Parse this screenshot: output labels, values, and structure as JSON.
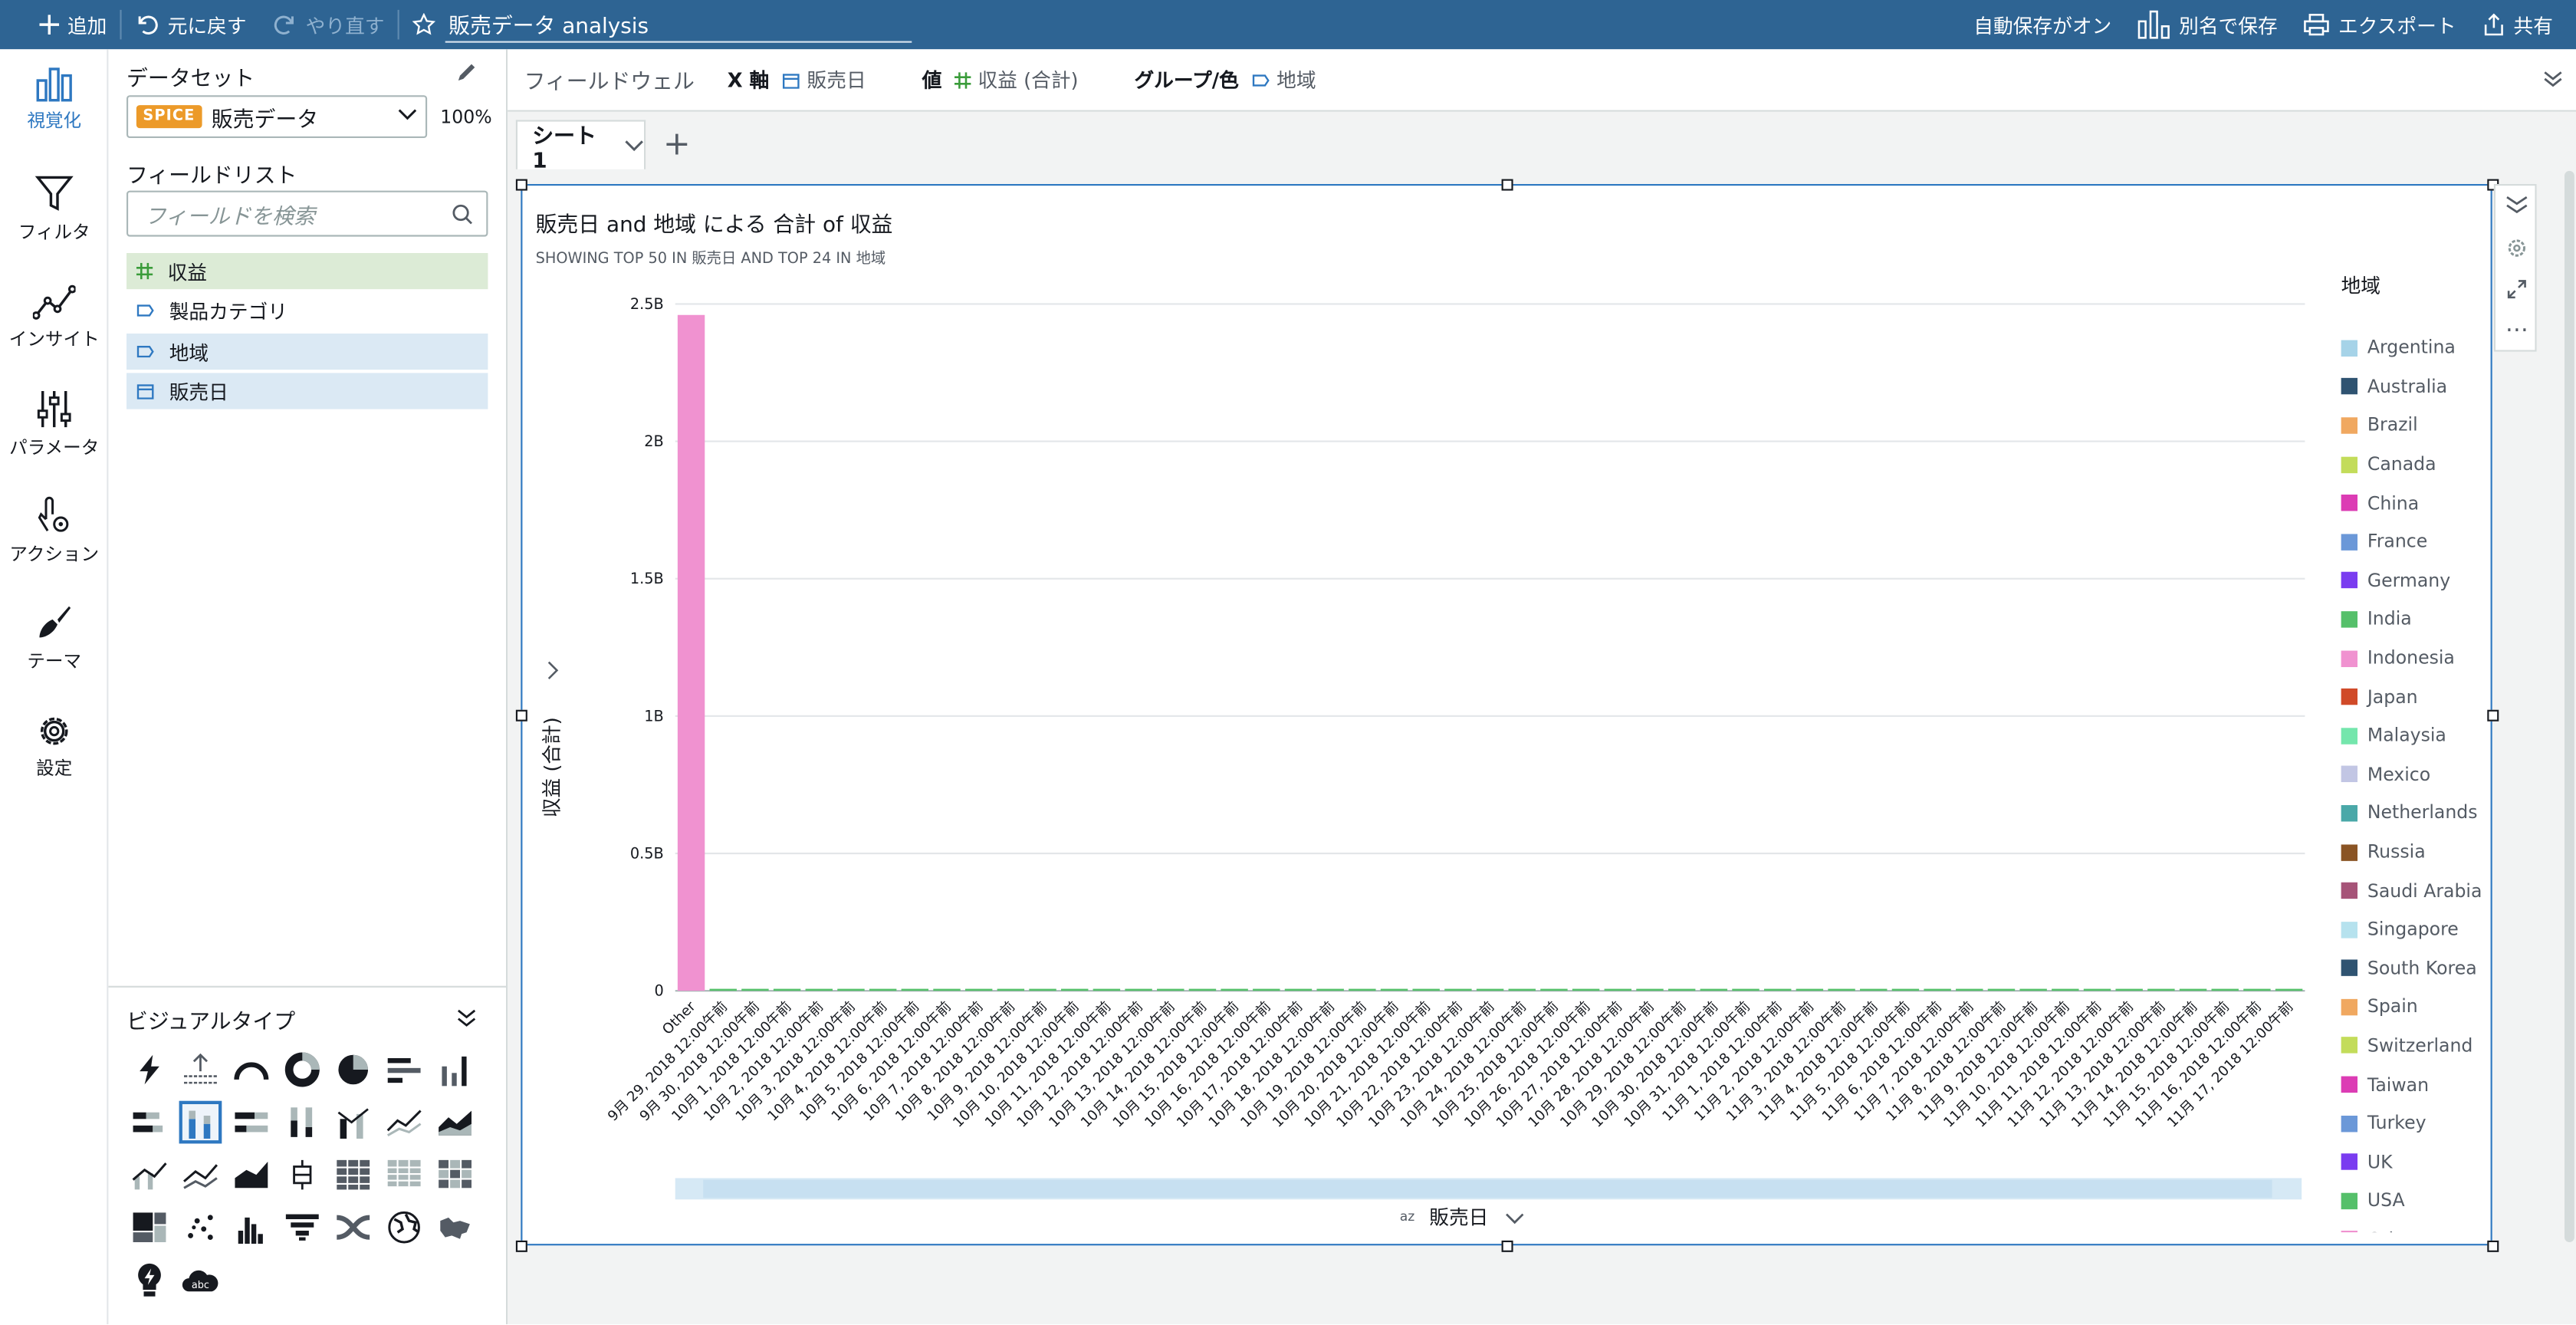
{
  "topbar": {
    "add": "追加",
    "undo": "元に戻す",
    "redo": "やり直す",
    "title": "販売データ analysis",
    "autosave": "自動保存がオン",
    "save_as": "別名で保存",
    "export": "エクスポート",
    "share": "共有"
  },
  "nav": [
    {
      "label": "視覚化",
      "icon": "visualize-icon"
    },
    {
      "label": "フィルタ",
      "icon": "filter-icon"
    },
    {
      "label": "インサイト",
      "icon": "insights-icon"
    },
    {
      "label": "パラメータ",
      "icon": "parameters-icon"
    },
    {
      "label": "アクション",
      "icon": "actions-icon"
    },
    {
      "label": "テーマ",
      "icon": "themes-icon"
    },
    {
      "label": "設定",
      "icon": "settings-icon"
    }
  ],
  "panel": {
    "dataset_title": "データセット",
    "spice": "SPICE",
    "dataset_name": "販売データ",
    "spice_pct": "100%",
    "fieldlist_title": "フィールドリスト",
    "search_placeholder": "フィールドを検索",
    "fields": [
      {
        "name": "収益",
        "kind": "measure"
      },
      {
        "name": "製品カテゴリ",
        "kind": "dimension"
      },
      {
        "name": "地域",
        "kind": "dimension-selected"
      },
      {
        "name": "販売日",
        "kind": "date-selected"
      }
    ],
    "visual_types_title": "ビジュアルタイプ"
  },
  "fieldwell": {
    "label": "フィールドウェル",
    "x_label": "X 軸",
    "x_value": "販売日",
    "value_label": "値",
    "value_value": "収益 (合計)",
    "group_label": "グループ/色",
    "group_value": "地域"
  },
  "sheet": {
    "tab": "シート 1"
  },
  "visual": {
    "title": "販売日 and 地域 による 合計 of 収益",
    "subtitle": "SHOWING TOP 50 IN 販売日 AND TOP 24 IN 地域",
    "legend_title": "地域",
    "legend": [
      {
        "name": "Argentina",
        "color": "#a6d3e8"
      },
      {
        "name": "Australia",
        "color": "#2f5371"
      },
      {
        "name": "Brazil",
        "color": "#f0a860"
      },
      {
        "name": "Canada",
        "color": "#c3dc5a"
      },
      {
        "name": "China",
        "color": "#dc3cb4"
      },
      {
        "name": "France",
        "color": "#6b98d8"
      },
      {
        "name": "Germany",
        "color": "#7a3cf0"
      },
      {
        "name": "India",
        "color": "#55c06a"
      },
      {
        "name": "Indonesia",
        "color": "#f092d0"
      },
      {
        "name": "Japan",
        "color": "#d04a28"
      },
      {
        "name": "Malaysia",
        "color": "#74e6ac"
      },
      {
        "name": "Mexico",
        "color": "#c2c6e4"
      },
      {
        "name": "Netherlands",
        "color": "#4aa8a8"
      },
      {
        "name": "Russia",
        "color": "#8a5424"
      },
      {
        "name": "Saudi Arabia",
        "color": "#a65478"
      },
      {
        "name": "Singapore",
        "color": "#b6e2ee"
      },
      {
        "name": "South Korea",
        "color": "#2f5371"
      },
      {
        "name": "Spain",
        "color": "#f0a860"
      },
      {
        "name": "Switzerland",
        "color": "#c3dc5a"
      },
      {
        "name": "Taiwan",
        "color": "#dc3cb4"
      },
      {
        "name": "Turkey",
        "color": "#6b98d8"
      },
      {
        "name": "UK",
        "color": "#7a3cf0"
      },
      {
        "name": "USA",
        "color": "#55c06a"
      },
      {
        "name": "Other",
        "color": "#f092d0"
      }
    ]
  },
  "chart_data": {
    "type": "bar",
    "title": "販売日 and 地域 による 合計 of 収益",
    "subtitle": "SHOWING TOP 50 IN 販売日 AND TOP 24 IN 地域",
    "xlabel": "販売日",
    "ylabel": "収益 (合計)",
    "ylim": [
      0,
      2500000000
    ],
    "yticks": [
      "0",
      "0.5B",
      "1B",
      "1.5B",
      "2B",
      "2.5B"
    ],
    "grid": true,
    "legend_placement": "right",
    "categories": [
      "Other",
      "9月 29, 2018 12:00午前",
      "9月 30, 2018 12:00午前",
      "10月 1, 2018 12:00午前",
      "10月 2, 2018 12:00午前",
      "10月 3, 2018 12:00午前",
      "10月 4, 2018 12:00午前",
      "10月 5, 2018 12:00午前",
      "10月 6, 2018 12:00午前",
      "10月 7, 2018 12:00午前",
      "10月 8, 2018 12:00午前",
      "10月 9, 2018 12:00午前",
      "10月 10, 2018 12:00午前",
      "10月 11, 2018 12:00午前",
      "10月 12, 2018 12:00午前",
      "10月 13, 2018 12:00午前",
      "10月 14, 2018 12:00午前",
      "10月 15, 2018 12:00午前",
      "10月 16, 2018 12:00午前",
      "10月 17, 2018 12:00午前",
      "10月 18, 2018 12:00午前",
      "10月 19, 2018 12:00午前",
      "10月 20, 2018 12:00午前",
      "10月 21, 2018 12:00午前",
      "10月 22, 2018 12:00午前",
      "10月 23, 2018 12:00午前",
      "10月 24, 2018 12:00午前",
      "10月 25, 2018 12:00午前",
      "10月 26, 2018 12:00午前",
      "10月 27, 2018 12:00午前",
      "10月 28, 2018 12:00午前",
      "10月 29, 2018 12:00午前",
      "10月 30, 2018 12:00午前",
      "10月 31, 2018 12:00午前",
      "11月 1, 2018 12:00午前",
      "11月 2, 2018 12:00午前",
      "11月 3, 2018 12:00午前",
      "11月 4, 2018 12:00午前",
      "11月 5, 2018 12:00午前",
      "11月 6, 2018 12:00午前",
      "11月 7, 2018 12:00午前",
      "11月 8, 2018 12:00午前",
      "11月 9, 2018 12:00午前",
      "11月 10, 2018 12:00午前",
      "11月 11, 2018 12:00午前",
      "11月 12, 2018 12:00午前",
      "11月 13, 2018 12:00午前",
      "11月 14, 2018 12:00午前",
      "11月 15, 2018 12:00午前",
      "11月 16, 2018 12:00午前",
      "11月 17, 2018 12:00午前"
    ],
    "series": [
      {
        "name": "Other",
        "color": "#f092d0",
        "values": [
          2460000000,
          0,
          0,
          0,
          0,
          0,
          0,
          0,
          0,
          0,
          0,
          0,
          0,
          0,
          0,
          0,
          0,
          0,
          0,
          0,
          0,
          0,
          0,
          0,
          0,
          0,
          0,
          0,
          0,
          0,
          0,
          0,
          0,
          0,
          0,
          0,
          0,
          0,
          0,
          0,
          0,
          0,
          0,
          0,
          0,
          0,
          0,
          0,
          0,
          0,
          0
        ]
      },
      {
        "name": "USA",
        "color": "#55c06a",
        "values": [
          0,
          4000000,
          4000000,
          4000000,
          4000000,
          4000000,
          4000000,
          4000000,
          4000000,
          4000000,
          4000000,
          4000000,
          4000000,
          4000000,
          4000000,
          4000000,
          4000000,
          4000000,
          4000000,
          4000000,
          4000000,
          4000000,
          4000000,
          4000000,
          4000000,
          4000000,
          4000000,
          4000000,
          4000000,
          4000000,
          4000000,
          4000000,
          4000000,
          4000000,
          4000000,
          4000000,
          4000000,
          4000000,
          4000000,
          4000000,
          4000000,
          4000000,
          4000000,
          4000000,
          4000000,
          4000000,
          4000000,
          4000000,
          4000000,
          4000000,
          4000000
        ]
      }
    ]
  }
}
